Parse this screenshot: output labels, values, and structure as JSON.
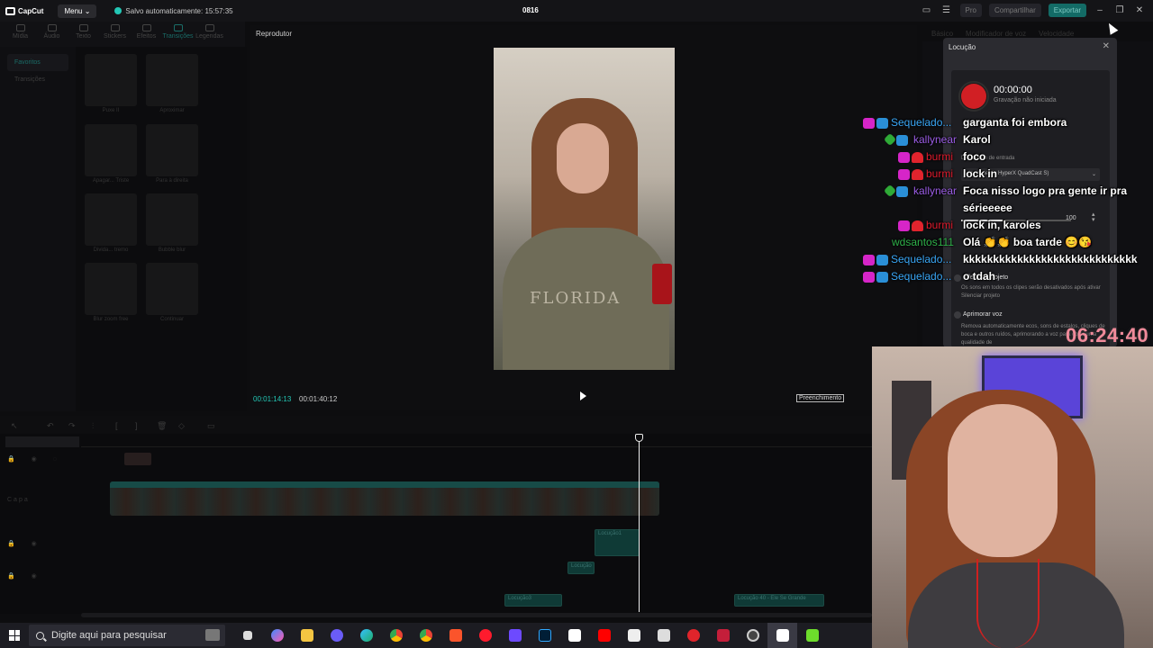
{
  "titlebar": {
    "app_name": "CapCut",
    "menu_label": "Menu",
    "autosave_text": "Salvo automaticamente: 15:57:35",
    "project_title": "0816",
    "pro_label": "Pro",
    "share_label": "Compartilhar",
    "export_label": "Exportar",
    "colors": {
      "accent": "#23c7b5",
      "export_bg": "#136b66"
    }
  },
  "toolbar": {
    "items": [
      "Mídia",
      "Áudio",
      "Texto",
      "Stickers",
      "Efeitos",
      "Transições",
      "Legendas"
    ],
    "active": "Transições"
  },
  "leftnav": {
    "items": [
      "Favoritos",
      "Transições"
    ]
  },
  "thumbs": {
    "labels": [
      "Puxe II",
      "Aproximar",
      "Apagar... Triste",
      "Para à direita",
      "Divida... tremo",
      "Bubble blur",
      "Blur zoom free",
      "Continuar"
    ]
  },
  "player": {
    "title": "Reprodutor",
    "current_time": "00:01:14:13",
    "total_time": "00:01:40:12",
    "fill_label": "Preenchimento",
    "video_shirt_text": "FLORIDA"
  },
  "props": {
    "tabs": [
      "Básico",
      "Modificador de voz",
      "Velocidade"
    ]
  },
  "locucao": {
    "title": "Locução",
    "record_time": "00:00:00",
    "record_status": "Gravação não iniciada",
    "input_label": "Dispositivo de entrada",
    "input_device": "Microfone (3- HyperX QuadCast S)",
    "volume_value": "100",
    "silence_title": "Silenciar projeto",
    "silence_desc": "Os sons em todos os clipes serão desativados após ativar Silenciar projeto",
    "enhance_title": "Aprimorar voz",
    "enhance_desc": "Remova automaticamente ecos, sons de estalos, cliques de boca e outros ruídos, aprimorando a voz para obter uma qualidade de"
  },
  "timeline": {
    "audio_clips": [
      "Locução1",
      "Locução",
      "Locução3",
      "Locução 40 - Ele Se Grande"
    ],
    "cover_label": "Capa"
  },
  "chat": {
    "messages": [
      {
        "user": "Sequelado...",
        "color": "#3aa6f5",
        "badges": [
          "gem",
          "tv"
        ],
        "text": "garganta foi embora"
      },
      {
        "user": "kallynear",
        "color": "#9b5de5",
        "badges": [
          "sword",
          "tv"
        ],
        "text": "Karol"
      },
      {
        "user": "burmi",
        "color": "#e01b2d",
        "badges": [
          "gem",
          "heart"
        ],
        "text": "foco"
      },
      {
        "user": "burmi",
        "color": "#e01b2d",
        "badges": [
          "gem",
          "heart"
        ],
        "text": "lock in"
      },
      {
        "user": "kallynear",
        "color": "#9b5de5",
        "badges": [
          "sword",
          "tv"
        ],
        "text": "Foca nisso logo pra gente ir pra"
      },
      {
        "user": "",
        "color": "#ffffff",
        "badges": [],
        "text": "sérieeeee"
      },
      {
        "user": "burmi",
        "color": "#e01b2d",
        "badges": [
          "gem",
          "heart"
        ],
        "text": "lock in, karoles"
      },
      {
        "user": "wdsantos111",
        "color": "#2fb14a",
        "badges": [],
        "text": "Olá 👏👏 boa tarde 😊😘"
      },
      {
        "user": "Sequelado...",
        "color": "#3aa6f5",
        "badges": [
          "gem",
          "tv"
        ],
        "text": "kkkkkkkkkkkkkkkkkkkkkkkkkkkkk"
      },
      {
        "user": "Sequelado...",
        "color": "#3aa6f5",
        "badges": [
          "gem",
          "tv"
        ],
        "text": "o tdah"
      }
    ]
  },
  "stream_timer": "06:24:40",
  "taskbar": {
    "search_placeholder": "Digite aqui para pesquisar",
    "apps": [
      "task-view",
      "copilot",
      "file-explorer",
      "cortana",
      "edge",
      "chrome",
      "chrome-profile",
      "brave",
      "opera",
      "proton-vpn",
      "photoshop",
      "capcut",
      "youtube",
      "store",
      "notion",
      "recorder",
      "streamer-app",
      "obs",
      "capcut-active",
      "winamp"
    ]
  }
}
